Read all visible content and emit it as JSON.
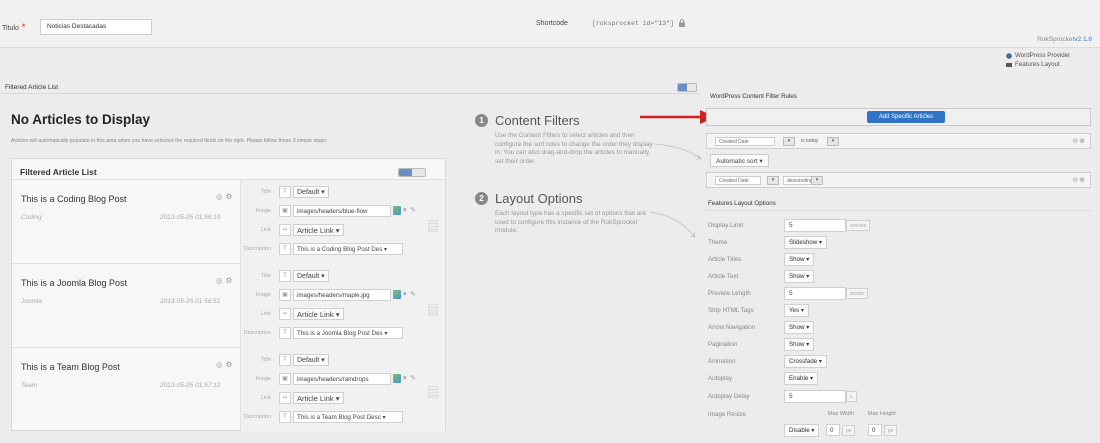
{
  "top": {
    "title_label": "Titulo",
    "title_required": "*",
    "title_value": "Noticias Destacadas",
    "shortcode_label": "Shortcode",
    "shortcode_value": "[roksprocket id=\"13\"]",
    "version_prefix": "RokSprocket",
    "version_number": "v2.1.6",
    "provider_label": "WordPress Provider",
    "layout_label": "Features Layout"
  },
  "left": {
    "bar_label": "Filtered Article List",
    "heading": "No Articles to Display",
    "help_text": "Articles will automatically populate in this area when you have selected the required fields on the right. Please follow these 3 simple steps:",
    "box_title": "Filtered Article List",
    "field_labels": {
      "title": "Title",
      "image": "Image",
      "link": "Link",
      "description": "Description"
    },
    "articles": [
      {
        "title": "This is a Coding Blog Post",
        "category": "Coding",
        "date": "2013-05-25 01:56:19",
        "title_sel": "Default",
        "image": "images/headers/blue-flow",
        "link": "Article Link",
        "desc": "This is a Coding Blog Post Des"
      },
      {
        "title": "This is a Joomla Blog Post",
        "category": "Joomla",
        "date": "2013-05-25 01:56:51",
        "title_sel": "Default",
        "image": "images/headers/maple.jpg",
        "link": "Article Link",
        "desc": "This is a Joomla Blog Post Des"
      },
      {
        "title": "This is a Team Blog Post",
        "category": "Team",
        "date": "2013-05-25 01:57:12",
        "title_sel": "Default",
        "image": "images/headers/raindrops",
        "link": "Article Link",
        "desc": "This is a Team Blog Post Desc"
      }
    ]
  },
  "steps": [
    {
      "num": "1",
      "title": "Content Filters",
      "text": "Use the Content Filters to select articles and then configure the sort rules to change the order they display in. You can also drag-and-drop the articles to manually set their order."
    },
    {
      "num": "2",
      "title": "Layout Options",
      "text": "Each layout type has a specific set of options that are used to configure this instance of the RokSprocket module."
    }
  ],
  "right": {
    "filter_label": "WordPress Content Filter Rules",
    "add_button": "Add Specific Articles",
    "rule1": {
      "field": "Created Date",
      "op": "is today"
    },
    "auto_sort": "Automatic sort",
    "rule2": {
      "field": "Created Date",
      "op": "descending"
    },
    "layout_label": "Features Layout Options",
    "options": {
      "display_limit": {
        "label": "Display Limit",
        "value": "5",
        "unit": "articles"
      },
      "theme": {
        "label": "Theme",
        "value": "Slideshow"
      },
      "article_titles": {
        "label": "Article Titles",
        "value": "Show"
      },
      "article_text": {
        "label": "Article Text",
        "value": "Show"
      },
      "preview_length": {
        "label": "Preview Length",
        "value": "5",
        "unit": "words"
      },
      "strip_html": {
        "label": "Strip HTML Tags",
        "value": "Yes"
      },
      "arrow_nav": {
        "label": "Arrow Navigation",
        "value": "Show"
      },
      "pagination": {
        "label": "Pagination",
        "value": "Show"
      },
      "animation": {
        "label": "Animation",
        "value": "Crossfade"
      },
      "autoplay": {
        "label": "Autoplay",
        "value": "Enable"
      },
      "autoplay_delay": {
        "label": "Autoplay Delay",
        "value": "5",
        "unit": "s"
      },
      "image_resize": {
        "label": "Image Resize",
        "value": "Disable",
        "max_width_label": "Max Width",
        "max_height_label": "Max Height",
        "width": "0",
        "height": "0",
        "unit": "px"
      }
    }
  },
  "colors": {
    "accent_blue": "#2f74c9",
    "arrow_red": "#d42020"
  }
}
